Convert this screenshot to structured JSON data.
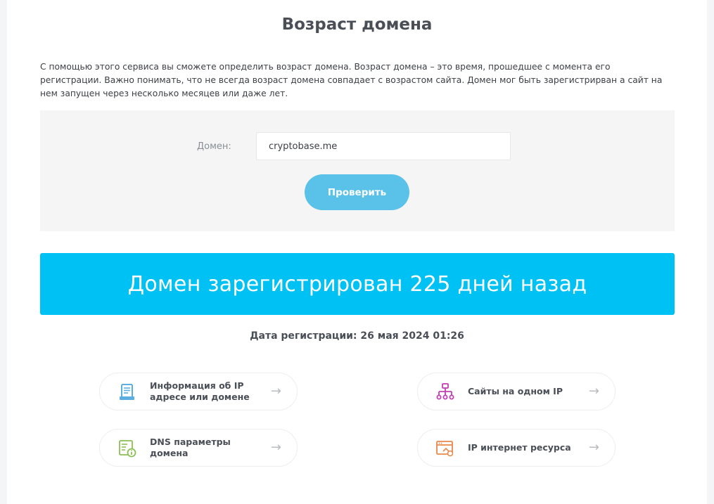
{
  "page": {
    "title": "Возраст домена",
    "intro": "С помощью этого сервиса вы сможете определить возраст домена. Возраст домена – это время, прошедшее с момента его регистрации. Важно понимать, что не всегда возраст домена совпадает с возрастом сайта. Домен мог быть зарегистрирван а сайт на нем запущен через несколько месяцев или даже лет."
  },
  "form": {
    "domain_label": "Домен:",
    "domain_value": "cryptobase.me",
    "submit_label": "Проверить"
  },
  "result": {
    "headline": "Домен зарегистрирован 225 дней назад",
    "registration_date": "Дата регистрации: 26 мая 2024 01:26"
  },
  "links": [
    {
      "label": "Информация об IP адресе или домене",
      "icon": "document-icon",
      "arrow": "→"
    },
    {
      "label": "Сайты на одном IP",
      "icon": "sitemap-icon",
      "arrow": "→"
    },
    {
      "label": "DNS параметры домена",
      "icon": "dns-info-icon",
      "arrow": "→"
    },
    {
      "label": "IP интернет ресурса",
      "icon": "browser-window-icon",
      "arrow": "→"
    }
  ],
  "colors": {
    "banner": "#00c1f3",
    "button": "#5ac1e8",
    "icon_blue": "#5aaee0",
    "icon_purple": "#c23fb3",
    "icon_green": "#8cbf54",
    "icon_orange": "#e8894a"
  }
}
